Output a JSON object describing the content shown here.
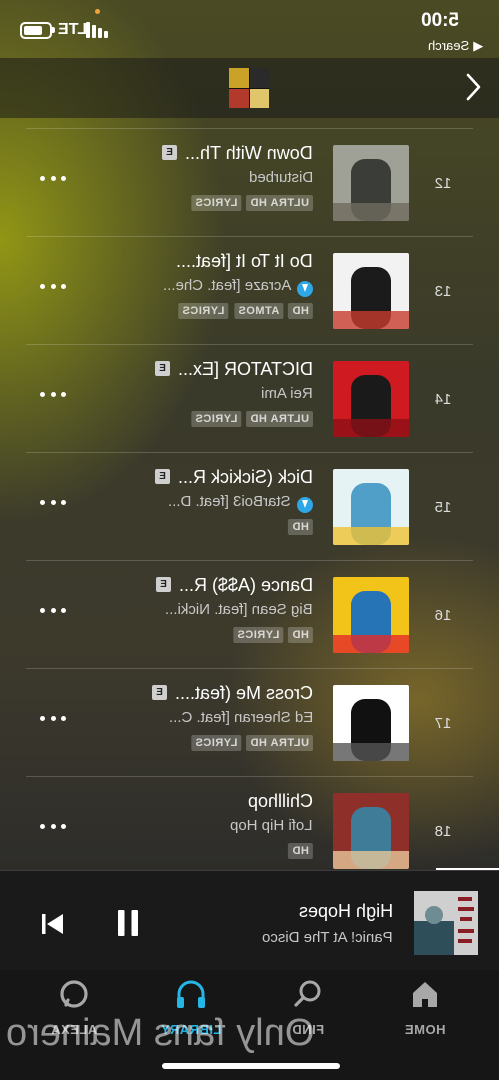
{
  "status": {
    "network": "LTE",
    "time": "5:00",
    "back_label": "Search"
  },
  "tracks": [
    {
      "num": "12",
      "title": "Down With Th...",
      "artist": "Disturbed",
      "explicit": "E",
      "downloaded": false,
      "badges": [
        "ULTRA HD",
        "LYRICS"
      ],
      "art_colors": [
        "#9fa096",
        "#3b3d38",
        "#6f6a5e"
      ]
    },
    {
      "num": "13",
      "title": "Do It To It [feat....",
      "artist": "Acraze [feat. Che...",
      "explicit": "",
      "downloaded": true,
      "badges": [
        "HD",
        "ATMOS",
        "LYRICS"
      ],
      "art_colors": [
        "#f2f2f2",
        "#1b1b1b",
        "#c73b2e"
      ]
    },
    {
      "num": "14",
      "title": "DICTATOR [Ex...",
      "artist": "Rei Ami",
      "explicit": "E",
      "downloaded": false,
      "badges": [
        "ULTRA HD",
        "LYRICS"
      ],
      "art_colors": [
        "#cf1a22",
        "#1a1a1a",
        "#8c0f16"
      ]
    },
    {
      "num": "15",
      "title": "Dick (Sickick R...",
      "artist": "StarBoi3 [feat. D...",
      "explicit": "E",
      "downloaded": true,
      "badges": [
        "HD"
      ],
      "art_colors": [
        "#e5f3f4",
        "#4f9fc9",
        "#f0c233"
      ]
    },
    {
      "num": "16",
      "title": "Dance (A$$) R...",
      "artist": "Big Sean [feat. Nicki...",
      "explicit": "E",
      "downloaded": false,
      "badges": [
        "HD",
        "LYRICS"
      ],
      "art_colors": [
        "#f2c318",
        "#2673b5",
        "#e32b2b"
      ]
    },
    {
      "num": "17",
      "title": "Cross Me (feat....",
      "artist": "Ed Sheeran [feat. C...",
      "explicit": "E",
      "downloaded": false,
      "badges": [
        "ULTRA HD",
        "LYRICS"
      ],
      "art_colors": [
        "#ffffff",
        "#111111",
        "#555555"
      ]
    },
    {
      "num": "18",
      "title": "Chillhop",
      "artist": "Lofi Hip Hop",
      "explicit": "",
      "downloaded": false,
      "badges": [
        "HD"
      ],
      "art_colors": [
        "#8f2f2a",
        "#3f7c98",
        "#e6c79a"
      ]
    }
  ],
  "now_playing": {
    "title": "High Hopes",
    "artist": "Panic! At The Disco"
  },
  "tabs": {
    "home": "HOME",
    "find": "FIND",
    "library": "LIBRARY",
    "alexa": "ALEXA"
  },
  "watermark": "Only fans Mainero",
  "colors": {
    "accent": "#25b6e8",
    "download": "#2fa6e5"
  }
}
